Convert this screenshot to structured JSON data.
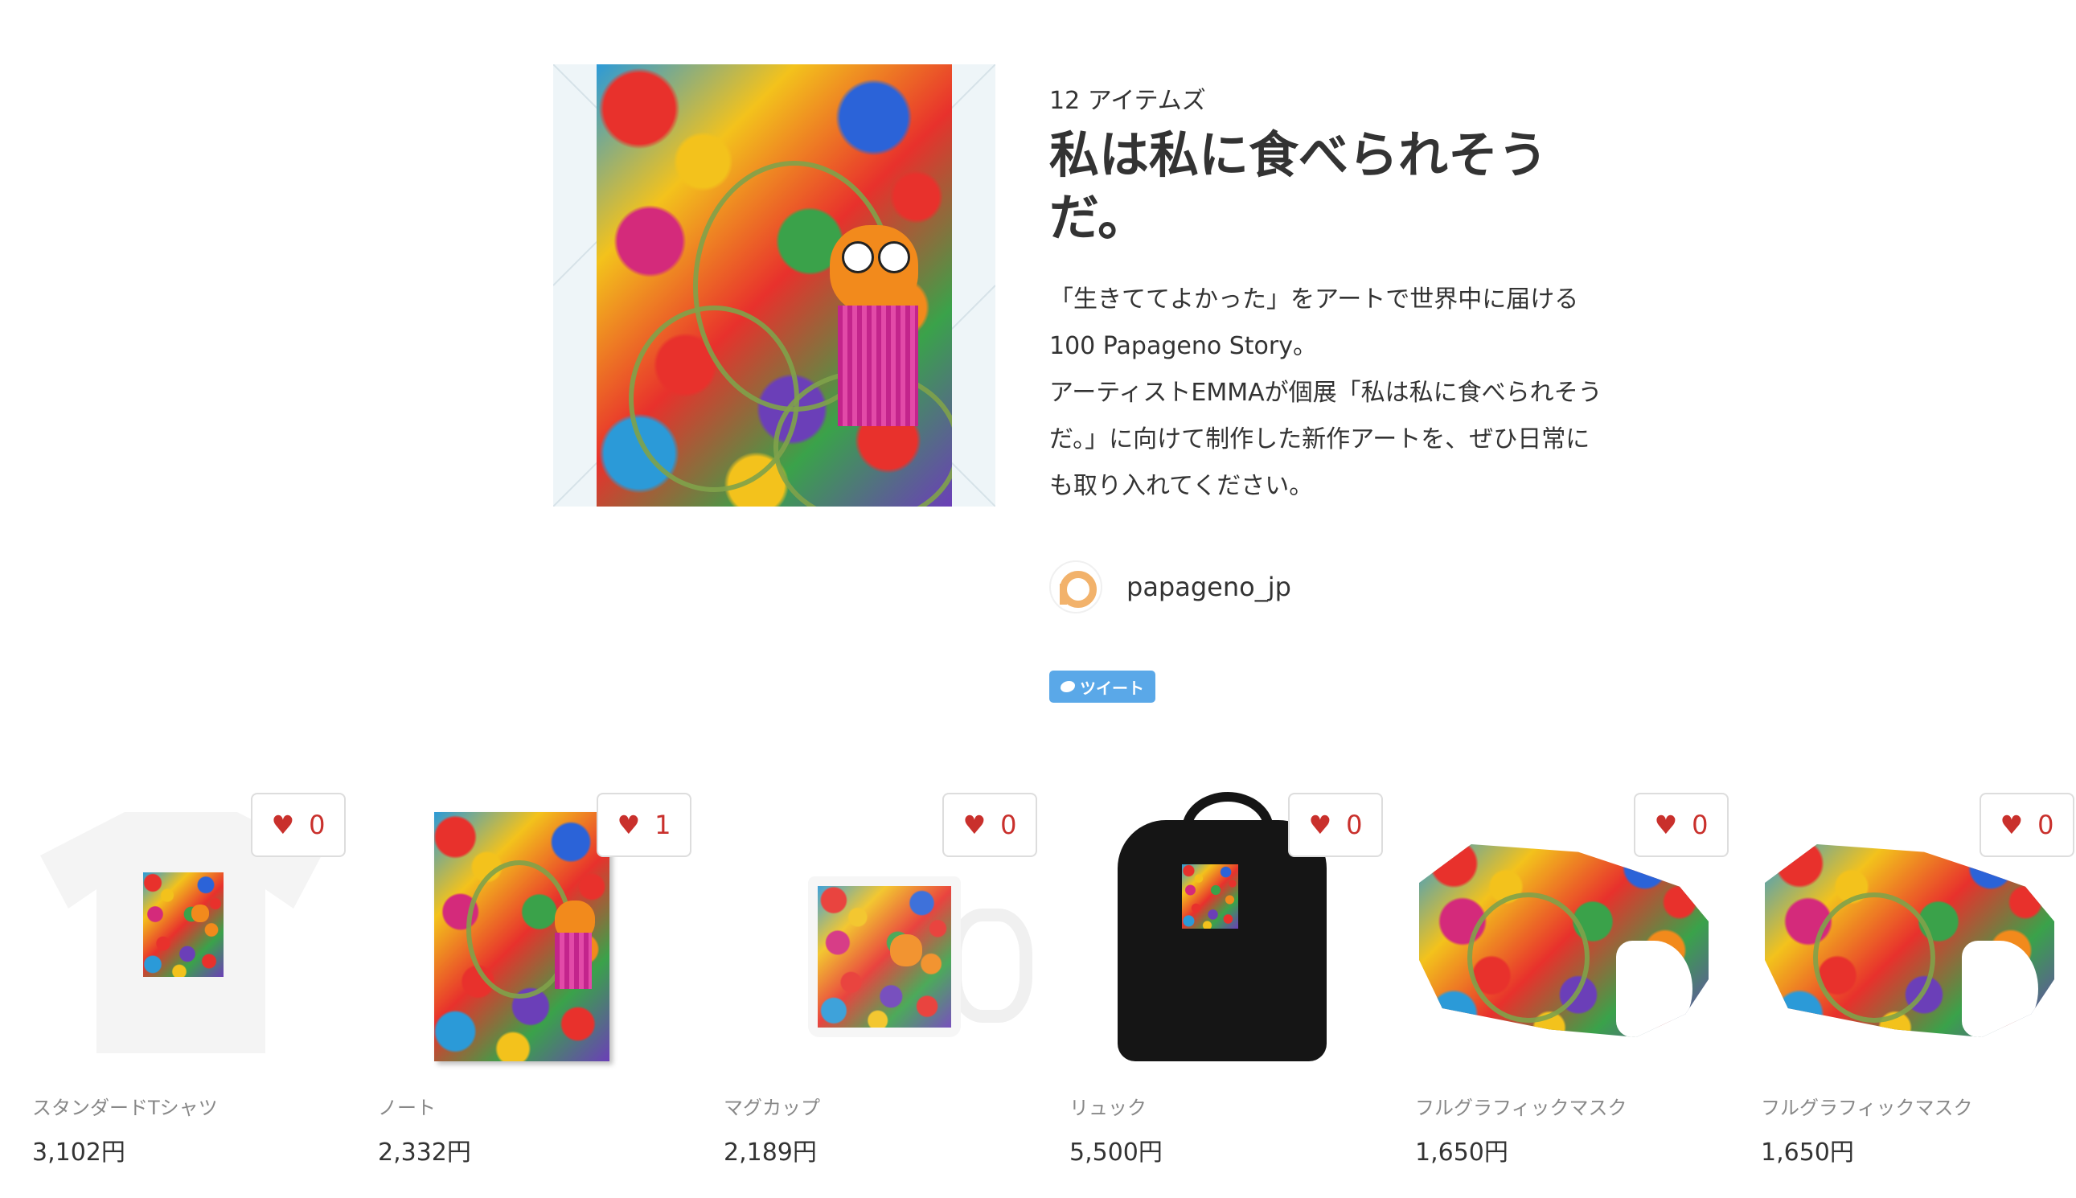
{
  "collection": {
    "item_count": "12 アイテムズ",
    "title": "私は私に食べられそうだ。",
    "description": "「生きててよかった」をアートで世界中に届ける100 Papageno Story。\nアーティストEMMAが個展「私は私に食べられそうだ。」に向けて制作した新作アートを、ぜひ日常にも取り入れてください。",
    "owner": "papageno_jp",
    "tweet_label": "ツイート"
  },
  "products": [
    {
      "name": "スタンダードTシャツ",
      "price": "3,102円",
      "likes": "0",
      "type": "tshirt"
    },
    {
      "name": "ノート",
      "price": "2,332円",
      "likes": "1",
      "type": "notebook"
    },
    {
      "name": "マグカップ",
      "price": "2,189円",
      "likes": "0",
      "type": "mug"
    },
    {
      "name": "リュック",
      "price": "5,500円",
      "likes": "0",
      "type": "backpack"
    },
    {
      "name": "フルグラフィックマスク",
      "price": "1,650円",
      "likes": "0",
      "type": "mask"
    },
    {
      "name": "フルグラフィックマスク",
      "price": "1,650円",
      "likes": "0",
      "type": "mask"
    }
  ],
  "colors": {
    "heart": "#c9302c",
    "tweet": "#5aa8e8",
    "avatar": "#f2b26b"
  },
  "icons": {
    "like": "heart-icon",
    "tweet": "twitter-bird-icon",
    "avatar": "papageno-logo-icon"
  }
}
